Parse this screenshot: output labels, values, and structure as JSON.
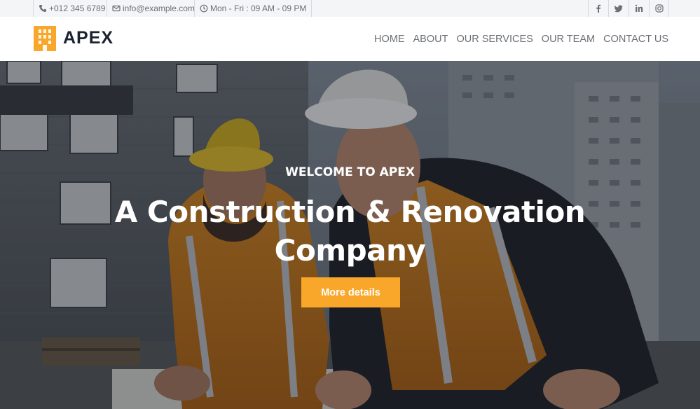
{
  "topbar": {
    "phone": "+012 345 6789",
    "email": "info@example.com",
    "hours": "Mon - Fri : 09 AM - 09 PM",
    "icons": [
      "phone-icon",
      "envelope-icon",
      "clock-icon"
    ],
    "social": [
      {
        "name": "facebook-icon",
        "glyph": "f"
      },
      {
        "name": "twitter-icon",
        "glyph": "t"
      },
      {
        "name": "linkedin-icon",
        "glyph": "in"
      },
      {
        "name": "instagram-icon",
        "glyph": "◎"
      }
    ]
  },
  "navbar": {
    "brand": "APEX",
    "items": [
      "HOME",
      "ABOUT",
      "OUR SERVICES",
      "OUR TEAM",
      "CONTACT US"
    ]
  },
  "hero": {
    "subtitle": "WELCOME TO APEX",
    "title_line1": "A Construction & Renovation",
    "title_line2": "Company",
    "button_label": "More details"
  },
  "colors": {
    "accent": "#f9a72a",
    "brand_text": "#1b2230",
    "nav_text": "#6b6f76",
    "topbar_bg": "#f4f5f7"
  }
}
